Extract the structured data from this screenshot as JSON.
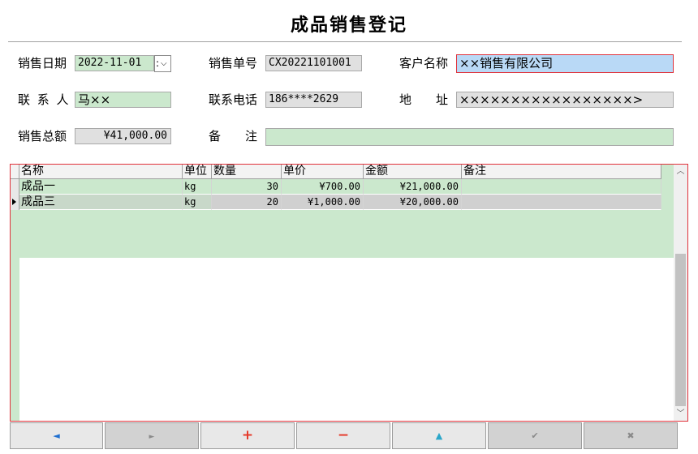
{
  "title": "成品销售登记",
  "form": {
    "sale_date_label": "销售日期",
    "sale_date_value": "2022-11-01",
    "sale_no_label": "销售单号",
    "sale_no_value": "CX20221101001",
    "customer_label": "客户名称",
    "customer_value": "××销售有限公司",
    "contact_label": "联 系 人",
    "contact_value": "马××",
    "phone_label": "联系电话",
    "phone_value": "186****2629",
    "address_label": "地　　址",
    "address_value": "×××××××××××××××××>",
    "total_label": "销售总额",
    "total_value": "¥41,000.00",
    "remark_label": "备　　注",
    "remark_value": ""
  },
  "grid": {
    "columns": [
      "名称",
      "单位",
      "数量",
      "单价",
      "金额",
      "备注"
    ],
    "rows": [
      {
        "name": "成品一",
        "unit": "kg",
        "qty": "30",
        "price": "¥700.00",
        "amount": "¥21,000.00",
        "remark": ""
      },
      {
        "name": "成品三",
        "unit": "kg",
        "qty": "20",
        "price": "¥1,000.00",
        "amount": "¥20,000.00",
        "remark": ""
      }
    ]
  },
  "nav": {
    "first": "◄",
    "next": "►",
    "add": "+",
    "delete": "−",
    "up": "▲",
    "confirm": "✔",
    "cancel": "✖"
  },
  "colors": {
    "field_green": "#cbe8cd",
    "field_blue": "#b9d9f6",
    "focus_border": "#e0313a",
    "nav_blue": "#1f6fd0",
    "nav_red": "#e53a2a",
    "nav_teal": "#2aa6c9"
  }
}
